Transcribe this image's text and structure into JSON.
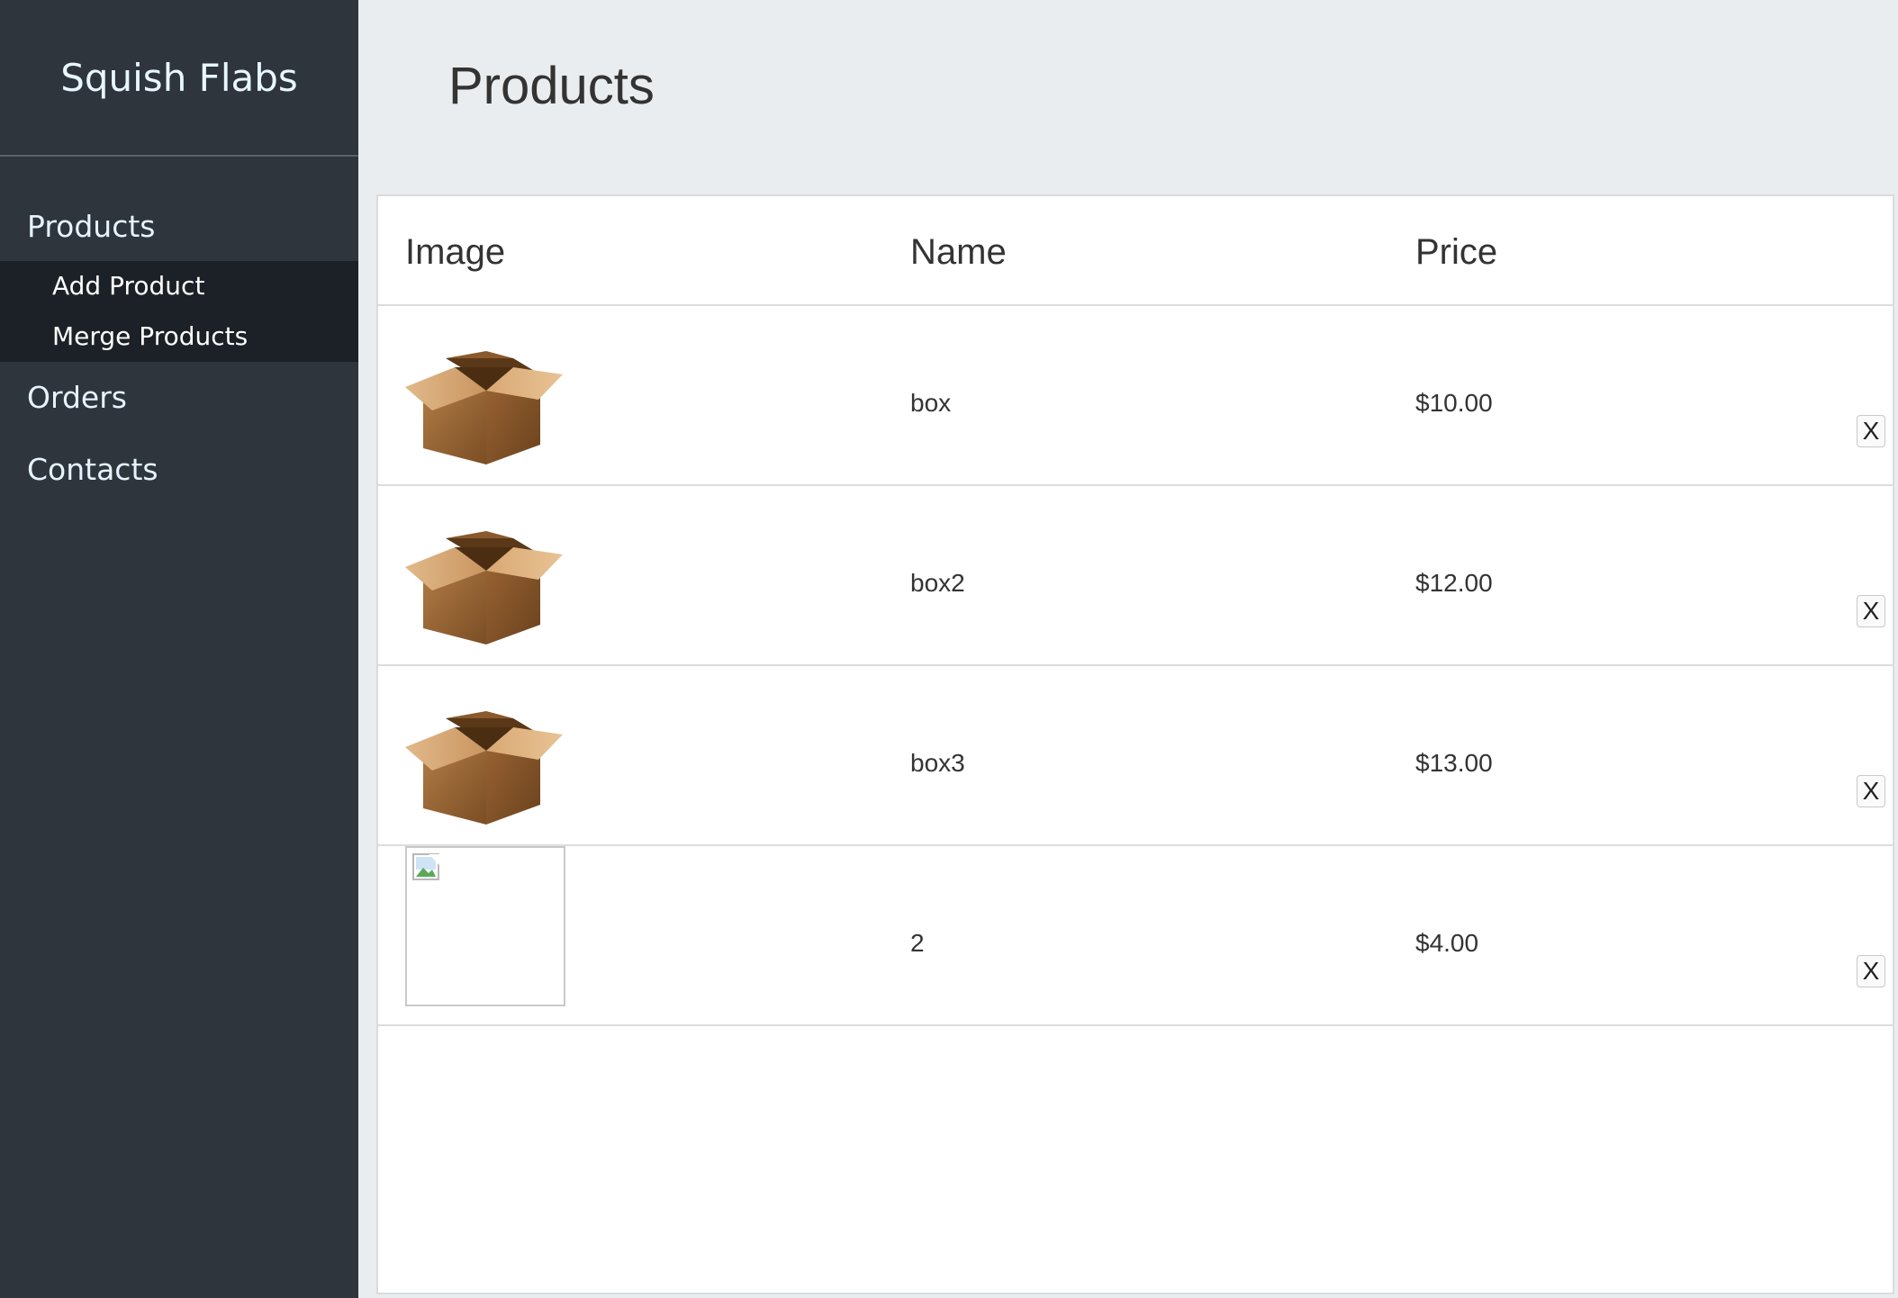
{
  "sidebar": {
    "brand": "Squish Flabs",
    "items": [
      {
        "label": "Products"
      },
      {
        "label": "Orders"
      },
      {
        "label": "Contacts"
      }
    ],
    "subitems": [
      {
        "label": "Add Product"
      },
      {
        "label": "Merge Products"
      }
    ]
  },
  "main": {
    "title": "Products",
    "table": {
      "headers": [
        "Image",
        "Name",
        "Price"
      ],
      "rows": [
        {
          "image": "box-icon",
          "name": "box",
          "price": "$10.00",
          "delete_label": "X"
        },
        {
          "image": "box-icon",
          "name": "box2",
          "price": "$12.00",
          "delete_label": "X"
        },
        {
          "image": "box-icon",
          "name": "box3",
          "price": "$13.00",
          "delete_label": "X"
        },
        {
          "image": "broken-image-icon",
          "name": "2",
          "price": "$4.00",
          "delete_label": "X"
        }
      ]
    }
  },
  "colors": {
    "sidebar_bg": "#2e353d",
    "subnav_bg": "#1c2128",
    "page_bg": "#e9edf0",
    "panel_bg": "#ffffff"
  }
}
